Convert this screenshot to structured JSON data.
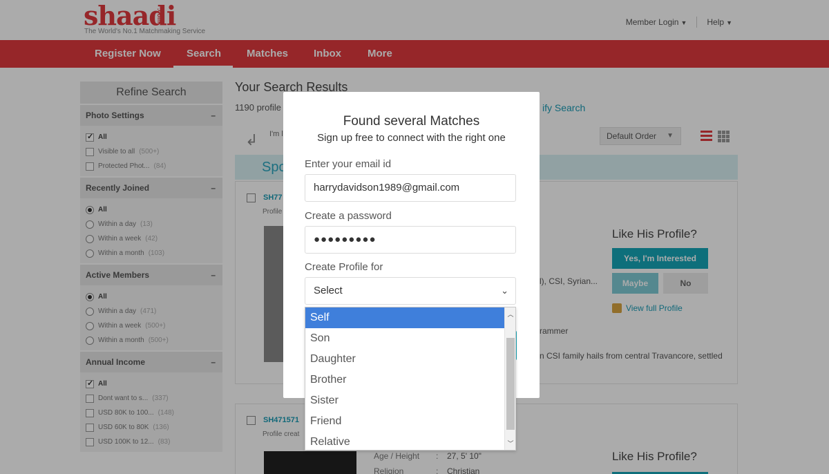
{
  "header": {
    "logo_text": "shaadi",
    "logo_suffix": ".com",
    "tagline": "The World's No.1 Matchmaking Service",
    "member_login": "Member Login",
    "help": "Help"
  },
  "nav": {
    "items": [
      "Register Now",
      "Search",
      "Matches",
      "Inbox",
      "More"
    ],
    "active": "Search"
  },
  "sidebar": {
    "title": "Refine Search",
    "sections": [
      {
        "title": "Photo Settings",
        "kind": "checkbox",
        "options": [
          {
            "label": "All",
            "count": "",
            "checked": true
          },
          {
            "label": "Visible to all",
            "count": "(500+)",
            "checked": false
          },
          {
            "label": "Protected Phot...",
            "count": "(84)",
            "checked": false
          }
        ]
      },
      {
        "title": "Recently Joined",
        "kind": "radio",
        "options": [
          {
            "label": "All",
            "count": "",
            "checked": true
          },
          {
            "label": "Within a day",
            "count": "(13)",
            "checked": false
          },
          {
            "label": "Within a week",
            "count": "(42)",
            "checked": false
          },
          {
            "label": "Within a month",
            "count": "(103)",
            "checked": false
          }
        ]
      },
      {
        "title": "Active Members",
        "kind": "radio",
        "options": [
          {
            "label": "All",
            "count": "",
            "checked": true
          },
          {
            "label": "Within a day",
            "count": "(471)",
            "checked": false
          },
          {
            "label": "Within a week",
            "count": "(500+)",
            "checked": false
          },
          {
            "label": "Within a month",
            "count": "(500+)",
            "checked": false
          }
        ]
      },
      {
        "title": "Annual Income",
        "kind": "checkbox",
        "options": [
          {
            "label": "All",
            "count": "",
            "checked": true
          },
          {
            "label": "Dont want to s...",
            "count": "(337)",
            "checked": false
          },
          {
            "label": "USD 80K to 100...",
            "count": "(148)",
            "checked": false
          },
          {
            "label": "USD 60K to 80K",
            "count": "(136)",
            "checked": false
          },
          {
            "label": "USD 100K to 12...",
            "count": "(83)",
            "checked": false
          }
        ]
      }
    ]
  },
  "results": {
    "title": "Your Search Results",
    "count_text": "1190 profile",
    "modify_link": "ify Search",
    "im_text": "I'm l",
    "sort_label": "Default Order",
    "spotlight": "Spo"
  },
  "cards": [
    {
      "profile_id": "SH77",
      "created": "Profile",
      "like_title": "Like His Profile?",
      "yes_label": "Yes, I'm Interested",
      "maybe_label": "Maybe",
      "no_label": "No",
      "view_full": "View full Profile",
      "detail_1": "l), CSI, Syrian...",
      "detail_2": "rammer",
      "detail_3": "n CSI family hails from central Travancore, settled"
    },
    {
      "profile_id": "SH471571",
      "created": "Profile creat",
      "like_title": "Like His Profile?",
      "attrs": [
        {
          "k": "Age / Height",
          "v": "27, 5' 10\""
        },
        {
          "k": "Religion",
          "v": "Christian"
        }
      ]
    }
  ],
  "modal": {
    "title": "Found several Matches",
    "subtitle": "Sign up free to connect with the right one",
    "email_label": "Enter your email id",
    "email_value": "harrydavidson1989@gmail.com",
    "password_label": "Create a password",
    "password_value": "●●●●●●●●●",
    "profile_for_label": "Create Profile for",
    "profile_for_value": "Select"
  },
  "dropdown": {
    "options": [
      "Self",
      "Son",
      "Daughter",
      "Brother",
      "Sister",
      "Friend",
      "Relative"
    ],
    "highlighted": "Self"
  },
  "colors": {
    "brand_red": "#e0393e",
    "teal": "#16a6b8",
    "highlight_blue": "#3f7fdb"
  }
}
